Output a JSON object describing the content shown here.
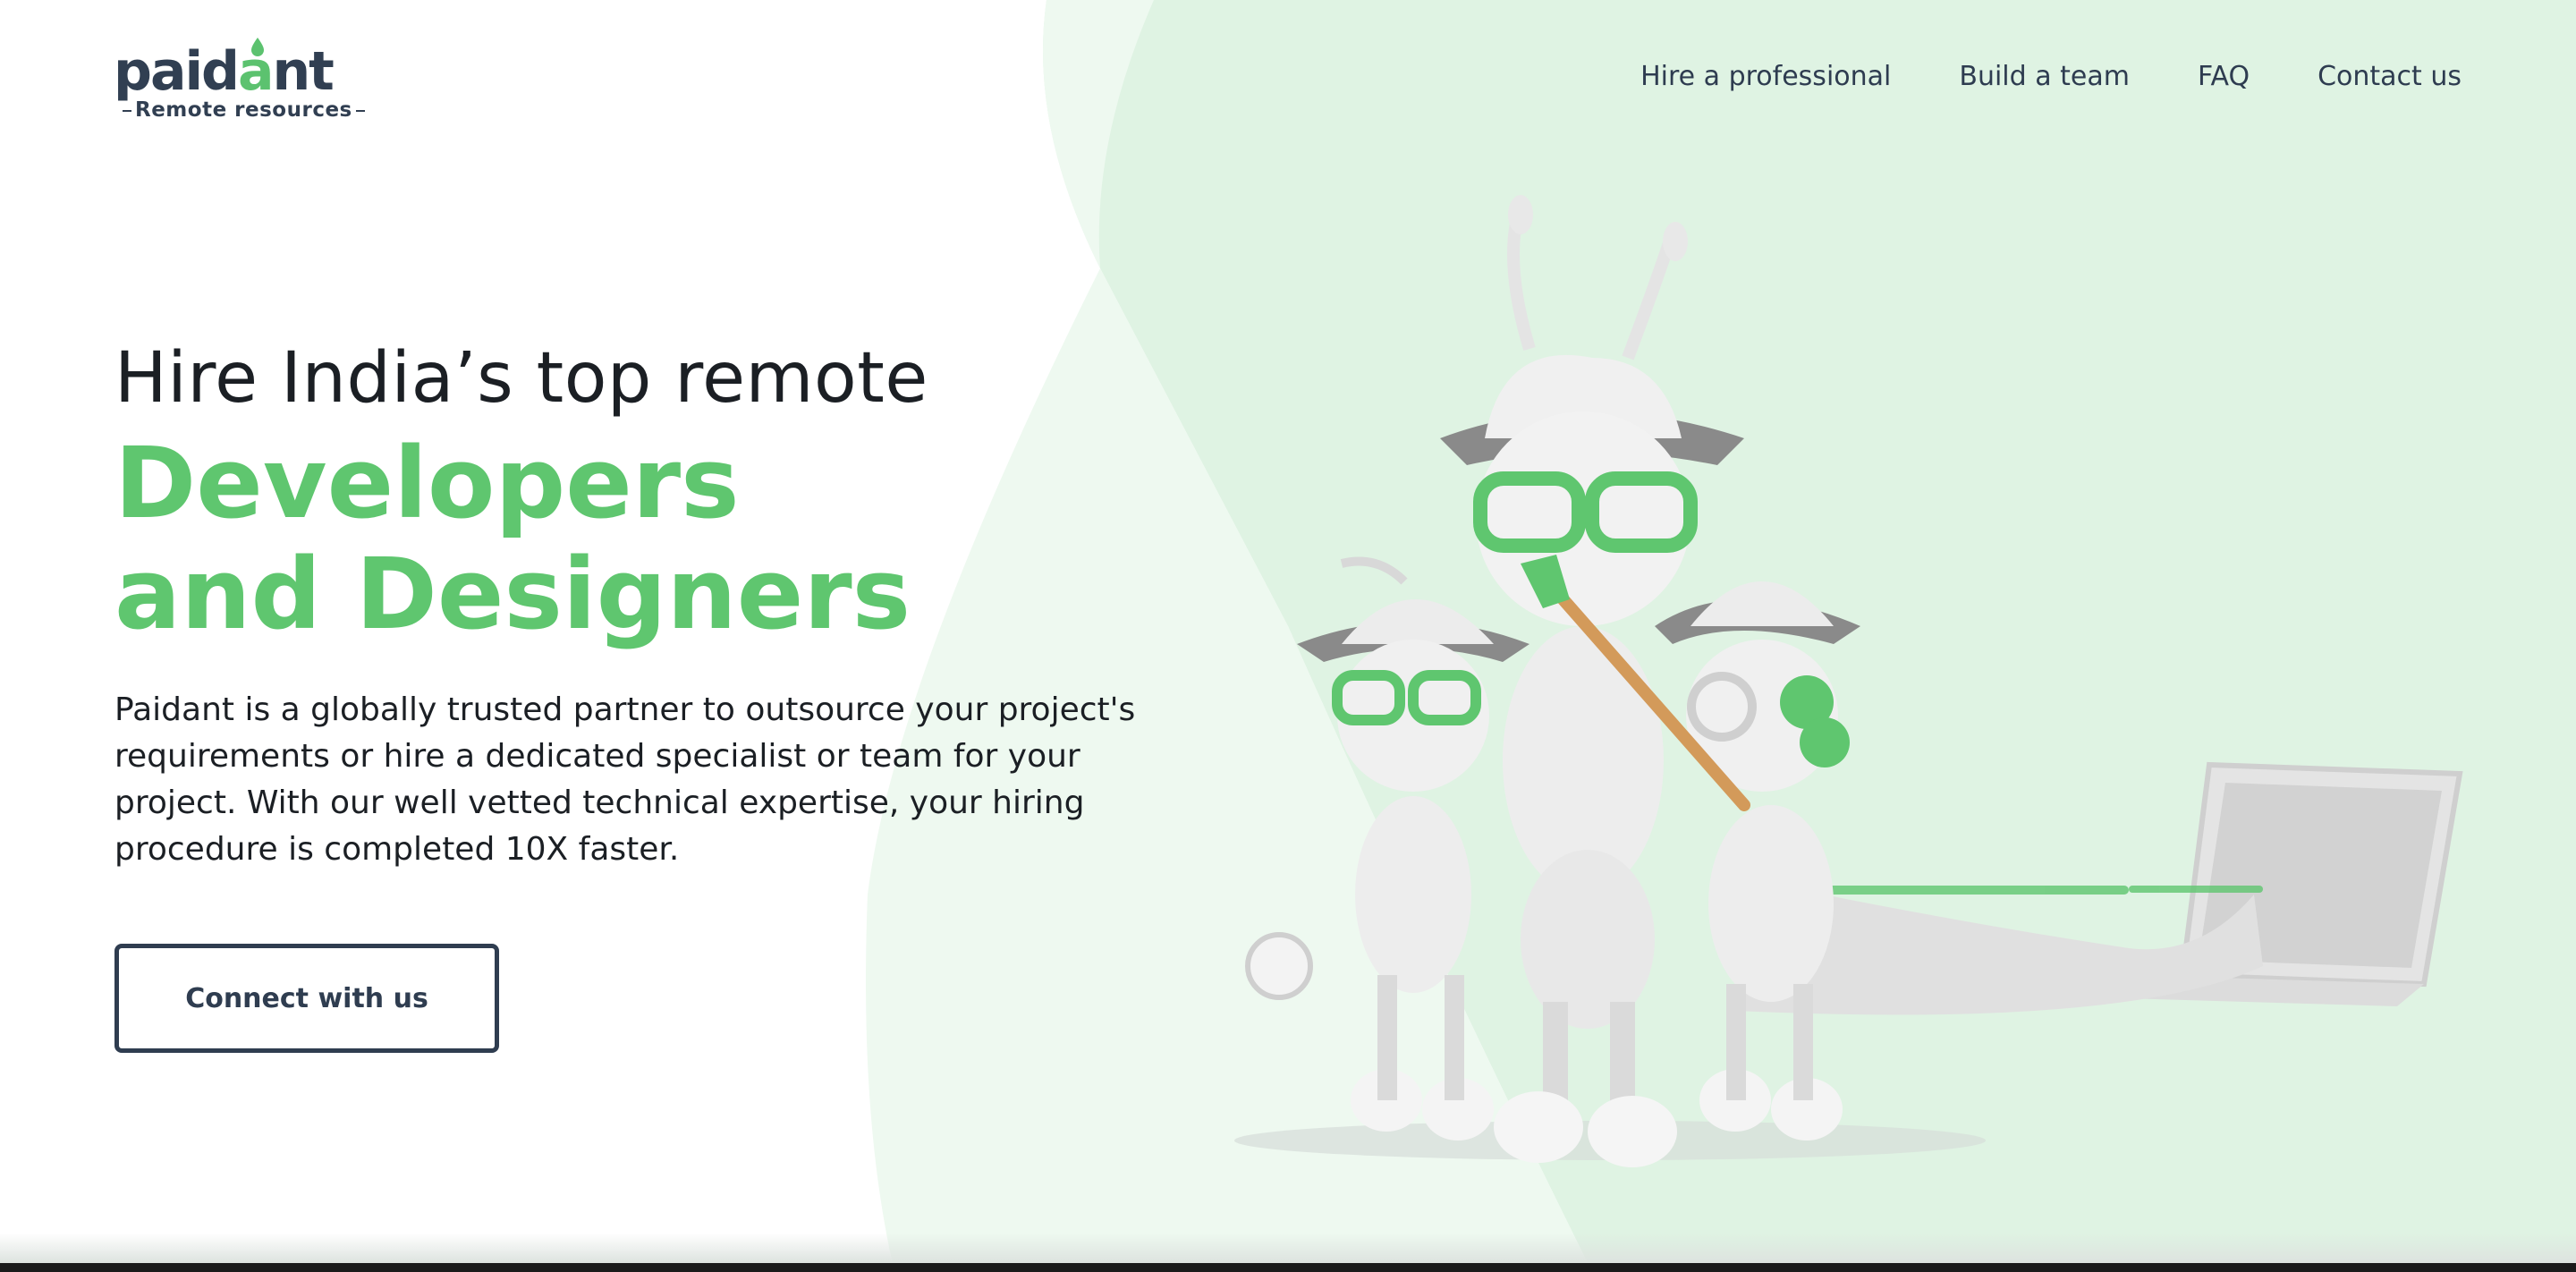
{
  "brand": {
    "name_part1": "paid",
    "name_part2": "a",
    "name_part3": "nt",
    "tagline": "Remote resources"
  },
  "nav": {
    "items": [
      {
        "label": "Hire a professional"
      },
      {
        "label": "Build a team"
      },
      {
        "label": "FAQ"
      },
      {
        "label": "Contact us"
      }
    ]
  },
  "hero": {
    "pre_title": "Hire India’s top remote",
    "title": "Developers and Designers",
    "description": "Paidant is a globally trusted partner to outsource your project's requirements or hire a dedicated specialist or team for your project. With our well vetted technical expertise, your hiring procedure is completed 10X faster.",
    "cta_label": "Connect with us"
  },
  "colors": {
    "accent_green": "#5fc66f",
    "navy": "#2f3d50",
    "bg_mint": "#dff3e3",
    "bg_mint_light": "#eef9f0"
  },
  "illustration": {
    "icon": "ant-team-illustration"
  }
}
